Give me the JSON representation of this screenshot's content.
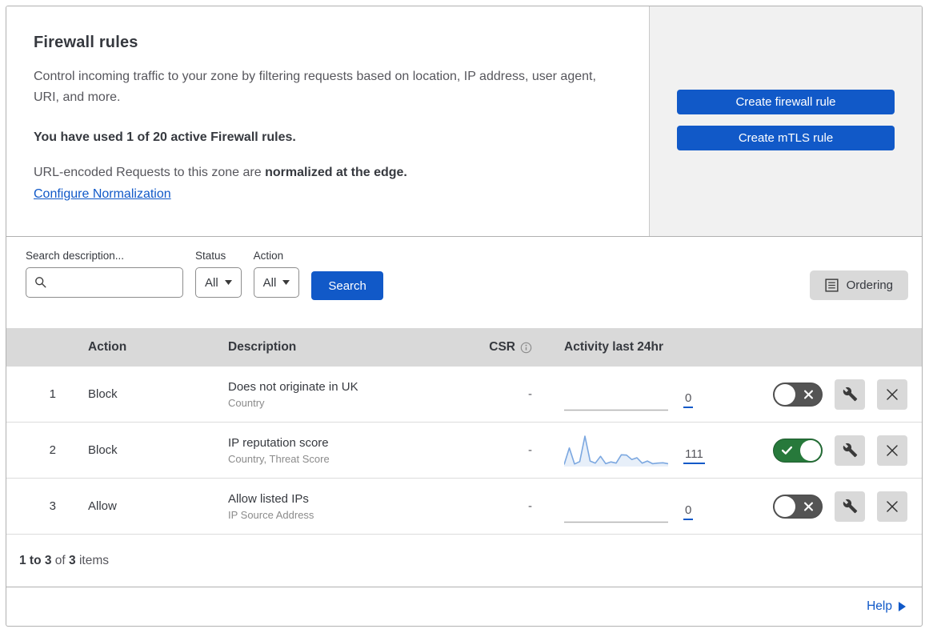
{
  "header": {
    "title": "Firewall rules",
    "description": "Control incoming traffic to your zone by filtering requests based on location, IP address, user agent, URI, and more.",
    "usage_line": "You have used 1 of 20 active Firewall rules.",
    "normalization_prefix": "URL-encoded Requests to this zone are",
    "normalization_bold": "normalized at the edge.",
    "normalization_link": "Configure Normalization",
    "create_firewall_button": "Create firewall rule",
    "create_mtls_button": "Create mTLS rule"
  },
  "filters": {
    "search_label": "Search description...",
    "search_value": "",
    "status_label": "Status",
    "status_value": "All",
    "action_label": "Action",
    "action_value": "All",
    "search_button": "Search",
    "ordering_button": "Ordering"
  },
  "table": {
    "columns": {
      "action": "Action",
      "description": "Description",
      "csr": "CSR",
      "activity": "Activity last 24hr"
    },
    "rows": [
      {
        "num": "1",
        "action": "Block",
        "description": "Does not originate in UK",
        "fields": "Country",
        "csr": "-",
        "activity_count": "0",
        "enabled": false,
        "sparkline": []
      },
      {
        "num": "2",
        "action": "Block",
        "description": "IP reputation score",
        "fields": "Country, Threat Score",
        "csr": "-",
        "activity_count": "111",
        "enabled": true,
        "sparkline": [
          4,
          60,
          6,
          14,
          100,
          16,
          9,
          32,
          7,
          13,
          9,
          37,
          36,
          21,
          27,
          9,
          16,
          7,
          9,
          10,
          7
        ]
      },
      {
        "num": "3",
        "action": "Allow",
        "description": "Allow listed IPs",
        "fields": "IP Source Address",
        "csr": "-",
        "activity_count": "0",
        "enabled": false,
        "sparkline": []
      }
    ]
  },
  "footer": {
    "range_bold": "1 to 3",
    "of_text": "of",
    "total_bold": "3",
    "items_text": "items",
    "help_label": "Help"
  },
  "colors": {
    "primary_blue": "#1159c8",
    "toggle_on_green": "#27793b",
    "toggle_off_gray": "#545454",
    "sparkline_blue": "#7ba7e0",
    "flatline_gray": "#b3b3b3"
  }
}
